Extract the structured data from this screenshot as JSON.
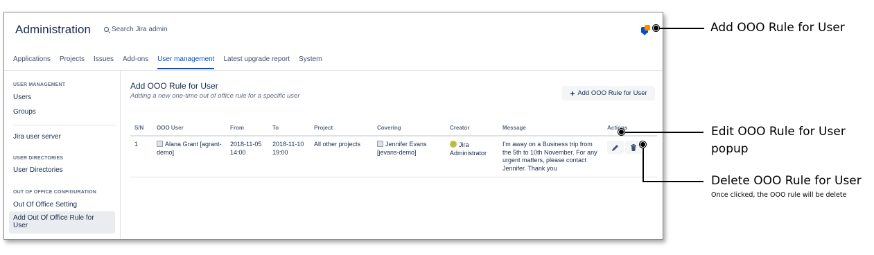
{
  "header": {
    "title": "Administration",
    "search_placeholder": "Search Jira admin",
    "notification_icon": "notification-icon"
  },
  "tabs": [
    "Applications",
    "Projects",
    "Issues",
    "Add-ons",
    "User management",
    "Latest upgrade report",
    "System"
  ],
  "active_tab": "User management",
  "sidebar": {
    "sections": [
      {
        "heading": "USER MANAGEMENT",
        "items": [
          "Users",
          "Groups"
        ]
      },
      {
        "heading": "",
        "items": [
          "Jira user server"
        ]
      },
      {
        "heading": "USER DIRECTORIES",
        "items": [
          "User Directories"
        ]
      },
      {
        "heading": "OUT OF OFFICE CONFIGURATION",
        "items": [
          "Out Of Office Setting",
          "Add Out Of Office Rule for User"
        ]
      }
    ],
    "active_item": "Add Out Of Office Rule for User"
  },
  "main": {
    "title": "Add OOO Rule for User",
    "subtitle": "Adding a new one-time out of office rule for a specific user",
    "add_button": "Add OOO Rule for User",
    "table": {
      "columns": [
        "S/N",
        "OOO User",
        "From",
        "To",
        "Project",
        "Covering",
        "Creator",
        "Message",
        "Actions"
      ],
      "rows": [
        {
          "sn": "1",
          "ooo_user": "Alana Grant [agrant-demo]",
          "from": "2018-11-05 14:00",
          "to": "2018-11-10 19:00",
          "project": "All other projects",
          "covering": "Jennifer Evans [jevans-demo]",
          "creator": "Jira Administrator",
          "message": "I'm away on a Business trip from the 5th to 10th November. For any urgent matters, please contact Jennifer. Thank you"
        }
      ]
    }
  },
  "callouts": [
    {
      "title": "Add OOO Rule for User",
      "desc": ""
    },
    {
      "title": "Edit OOO Rule for User popup",
      "desc": ""
    },
    {
      "title": "Delete OOO Rule for User",
      "desc": "Once clicked, the OOO rule will be delete"
    }
  ]
}
